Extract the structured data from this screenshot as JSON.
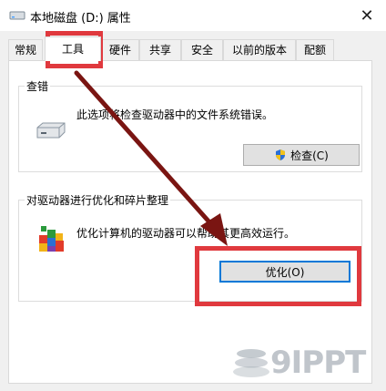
{
  "window": {
    "title": "本地磁盘 (D:) 属性",
    "close_label": "✕"
  },
  "tabs": [
    {
      "label": "常规",
      "active": false
    },
    {
      "label": "工具",
      "active": true
    },
    {
      "label": "硬件",
      "active": false
    },
    {
      "label": "共享",
      "active": false
    },
    {
      "label": "安全",
      "active": false
    },
    {
      "label": "以前的版本",
      "active": false
    },
    {
      "label": "配额",
      "active": false
    }
  ],
  "error_check": {
    "title": "查错",
    "description": "此选项将检查驱动器中的文件系统错误。",
    "button_label": "检查(C)",
    "icon": "drive-icon"
  },
  "optimize": {
    "title": "对驱动器进行优化和碎片整理",
    "description": "优化计算机的驱动器可以帮助其更高效运行。",
    "button_label": "优化(O)",
    "icon": "defrag-icon"
  },
  "annotation": {
    "color": "#e0393e",
    "arrow_color": "#7a1512"
  },
  "watermark": {
    "text": "9IPPT"
  }
}
